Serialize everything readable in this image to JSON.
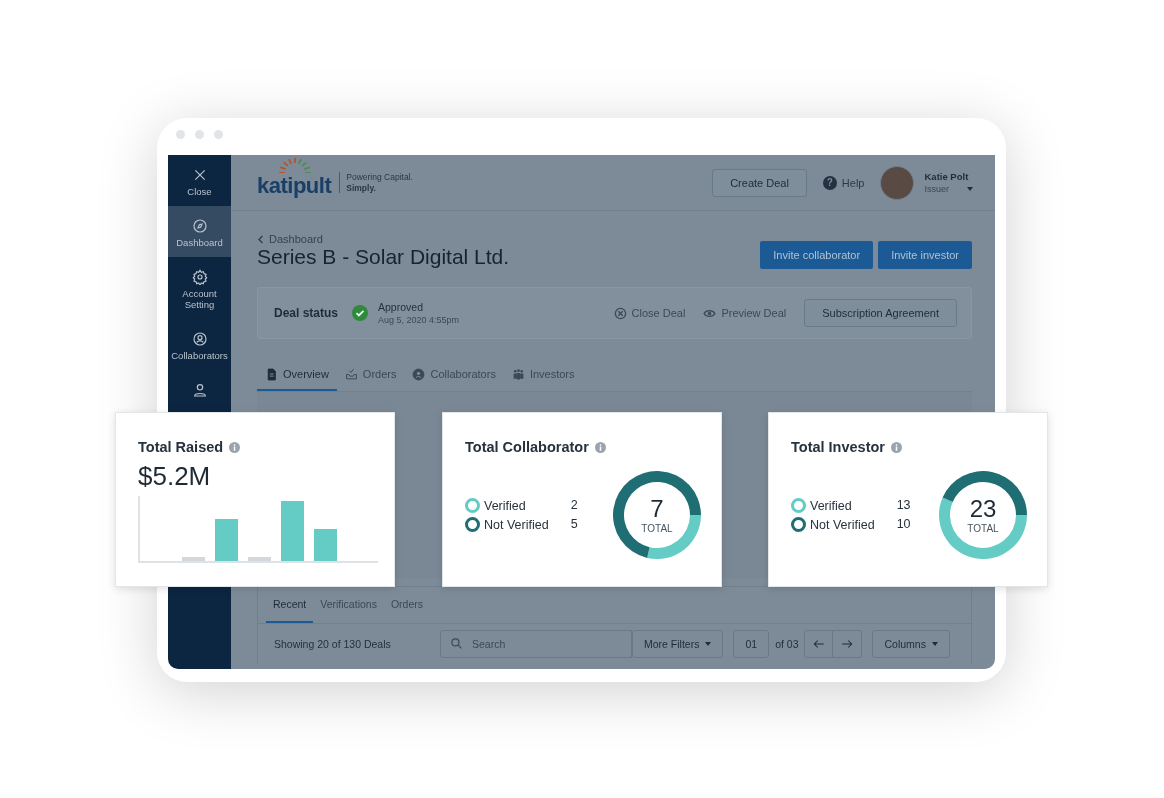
{
  "sidebar": {
    "items": [
      {
        "kind": "close",
        "label": "Close",
        "selected": false
      },
      {
        "kind": "dashboard",
        "label": "Dashboard",
        "selected": true
      },
      {
        "kind": "settings",
        "label": "Account Setting",
        "selected": false
      },
      {
        "kind": "collaborators",
        "label": "Collaborators",
        "selected": false
      },
      {
        "kind": "user",
        "selected": false
      }
    ]
  },
  "header": {
    "logo": "katipult",
    "tagline": "Powering Capital.",
    "tagline_bold": "Simply.",
    "create_button": "Create Deal",
    "help_icon": "?",
    "help": "Help",
    "user": {
      "name": "Katie Polt",
      "role": "Issuer"
    }
  },
  "deal": {
    "breadcrumb": "Dashboard",
    "title": "Series B - Solar Digital Ltd.",
    "buttons": [
      "Invite collaborator",
      "Invite investor"
    ],
    "status_label": "Deal status",
    "status": "Approved",
    "status_date": "Aug 5, 2020 4:55pm",
    "close_deal": "Close Deal",
    "preview_deal": "Preview Deal",
    "agreement_button": "Subscription Agreement"
  },
  "tabs": [
    {
      "label": "Overview",
      "kind": "doc",
      "selected": true
    },
    {
      "label": "Orders",
      "kind": "tray",
      "selected": false
    },
    {
      "label": "Collaborators",
      "kind": "person",
      "selected": false
    },
    {
      "label": "Investors",
      "kind": "group",
      "selected": false
    }
  ],
  "list": {
    "tabs": [
      {
        "label": "Recent",
        "selected": true
      },
      {
        "label": "Verifications",
        "selected": false
      },
      {
        "label": "Orders",
        "selected": false
      }
    ],
    "showing": "Showing 20 of 130 Deals",
    "search_placeholder": "Search",
    "more_filters": "More Filters",
    "page": "01",
    "of_pages": "of 03",
    "columns": "Columns"
  },
  "cards": [
    {
      "kind": "bars",
      "title": "Total Raised",
      "value": "$5.2M"
    },
    {
      "kind": "donut",
      "title": "Total Collaborator",
      "total": "7",
      "total_label": "TOTAL",
      "legend": [
        {
          "label": "Verified",
          "count": "2",
          "color": "#64ccc5"
        },
        {
          "label": "Not Verified",
          "count": "5",
          "color": "#1f6e73"
        }
      ],
      "chart_data": {
        "type": "donut",
        "values": [
          28.6,
          71.4
        ]
      }
    },
    {
      "kind": "donut",
      "title": "Total Investor",
      "total": "23",
      "total_label": "TOTAL",
      "legend": [
        {
          "label": "Verified",
          "count": "13",
          "color": "#64ccc5"
        },
        {
          "label": "Not Verified",
          "count": "10",
          "color": "#1f6e73"
        }
      ],
      "chart_data": {
        "type": "donut",
        "values": [
          56.5,
          43.5
        ]
      }
    }
  ]
}
